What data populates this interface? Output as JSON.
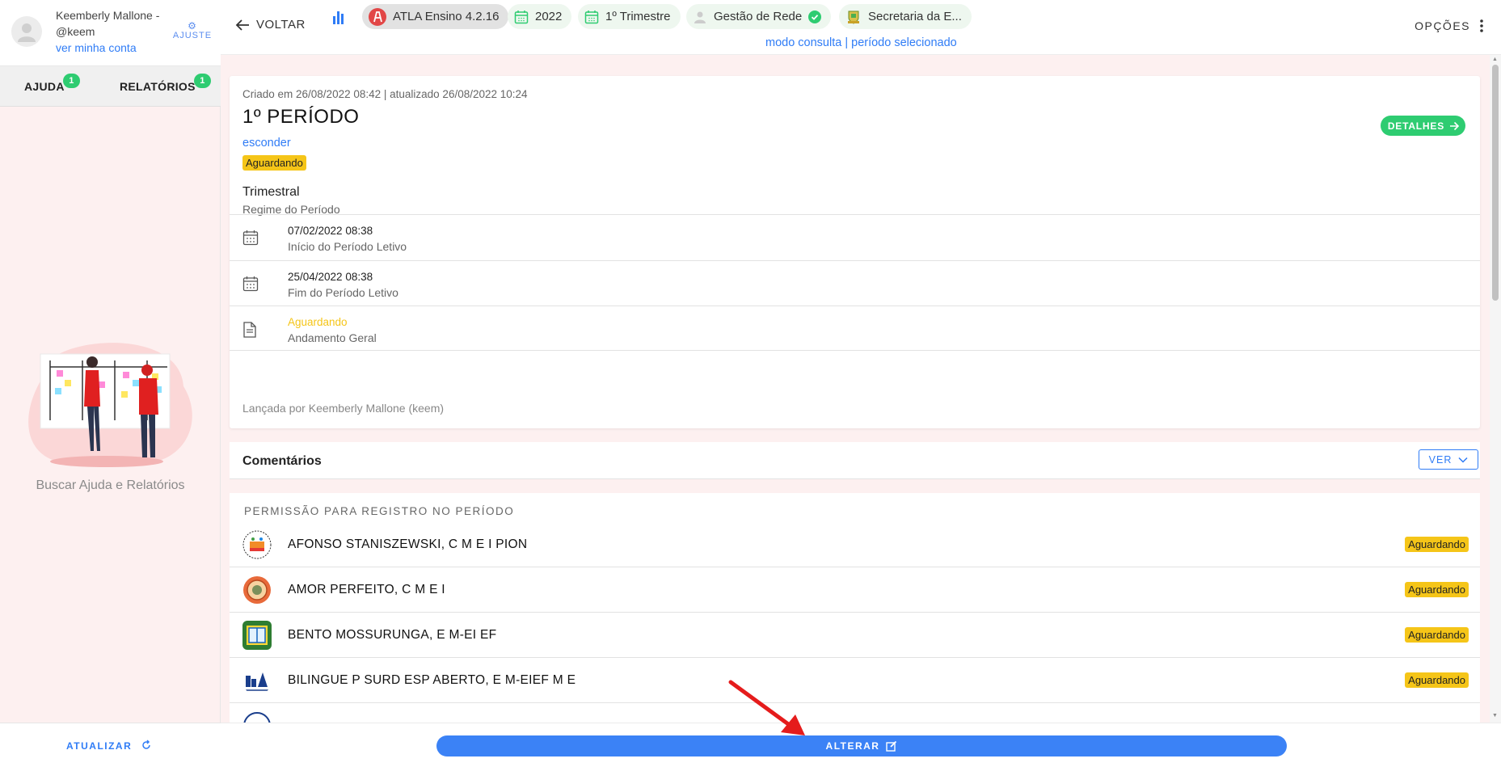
{
  "user": {
    "name": "Keemberly Mallone - @keem",
    "account_link": "ver minha conta",
    "settings_label": "AJUSTE"
  },
  "sidebar": {
    "tabs": [
      {
        "label": "AJUDA",
        "count": "1"
      },
      {
        "label": "RELATÓRIOS",
        "count": "1"
      }
    ],
    "help_text": "Buscar Ajuda e Relatórios",
    "refresh_label": "ATUALIZAR"
  },
  "topbar": {
    "back_label": "VOLTAR",
    "chips": [
      {
        "label": "ATLA Ensino 4.2.16",
        "icon": "atla-logo-icon"
      },
      {
        "label": "2022",
        "icon": "calendar-icon"
      },
      {
        "label": "1º Trimestre",
        "icon": "calendar-icon"
      },
      {
        "label": "Gestão de Rede",
        "icon": "user-icon"
      },
      {
        "label": "Secretaria da E...",
        "icon": "crest-icon"
      }
    ],
    "mode_text": "modo consulta | período selecionado",
    "options_label": "OPÇÕES"
  },
  "period": {
    "created": "Criado em 26/08/2022 08:42 | atualizado 26/08/2022 10:24",
    "title": "1º PERÍODO",
    "hide_link": "esconder",
    "status": "Aguardando",
    "details_button": "DETALHES",
    "regime_value": "Trimestral",
    "regime_label": "Regime do Período",
    "rows": [
      {
        "value": "07/02/2022 08:38",
        "label": "Início do Período Letivo",
        "icon": "calendar-icon"
      },
      {
        "value": "25/04/2022 08:38",
        "label": "Fim do Período Letivo",
        "icon": "calendar-icon"
      },
      {
        "value": "Aguardando",
        "label": "Andamento Geral",
        "icon": "document-icon"
      }
    ],
    "launched_by": "Lançada por Keemberly Mallone (keem)"
  },
  "comments": {
    "title": "Comentários",
    "view_button": "VER"
  },
  "permissions": {
    "heading": "PERMISSÃO PARA REGISTRO NO PERÍODO",
    "schools": [
      {
        "name": "AFONSO STANISZEWSKI, C M E I PION",
        "status": "Aguardando"
      },
      {
        "name": "AMOR PERFEITO, C M E I",
        "status": "Aguardando"
      },
      {
        "name": "BENTO MOSSURUNGA, E M-EI EF",
        "status": "Aguardando"
      },
      {
        "name": "BILINGUE P SURD ESP ABERTO, E M-EIEF M E",
        "status": "Aguardando"
      }
    ]
  },
  "footer": {
    "edit_button": "ALTERAR"
  },
  "colors": {
    "accent": "#2f7cf6",
    "success": "#2ecc71",
    "waiting": "#f5c518",
    "background": "#fdf0f0"
  }
}
